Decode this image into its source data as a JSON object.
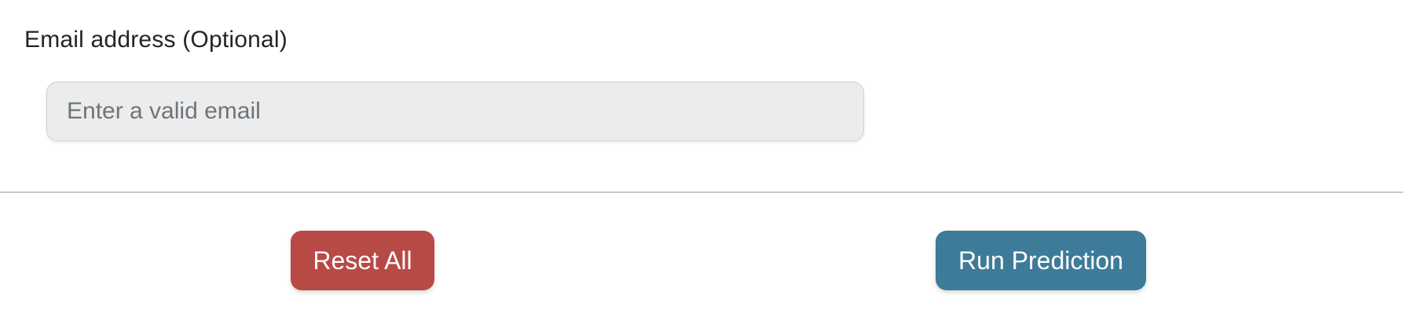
{
  "email_field": {
    "label": "Email address (Optional)",
    "value": "",
    "placeholder": "Enter a valid email"
  },
  "actions": {
    "reset_label": "Reset All",
    "run_label": "Run Prediction"
  },
  "colors": {
    "reset_button": "#b84a45",
    "run_button": "#3d7b99",
    "input_background": "#ececec",
    "divider": "#c8c8c8"
  }
}
